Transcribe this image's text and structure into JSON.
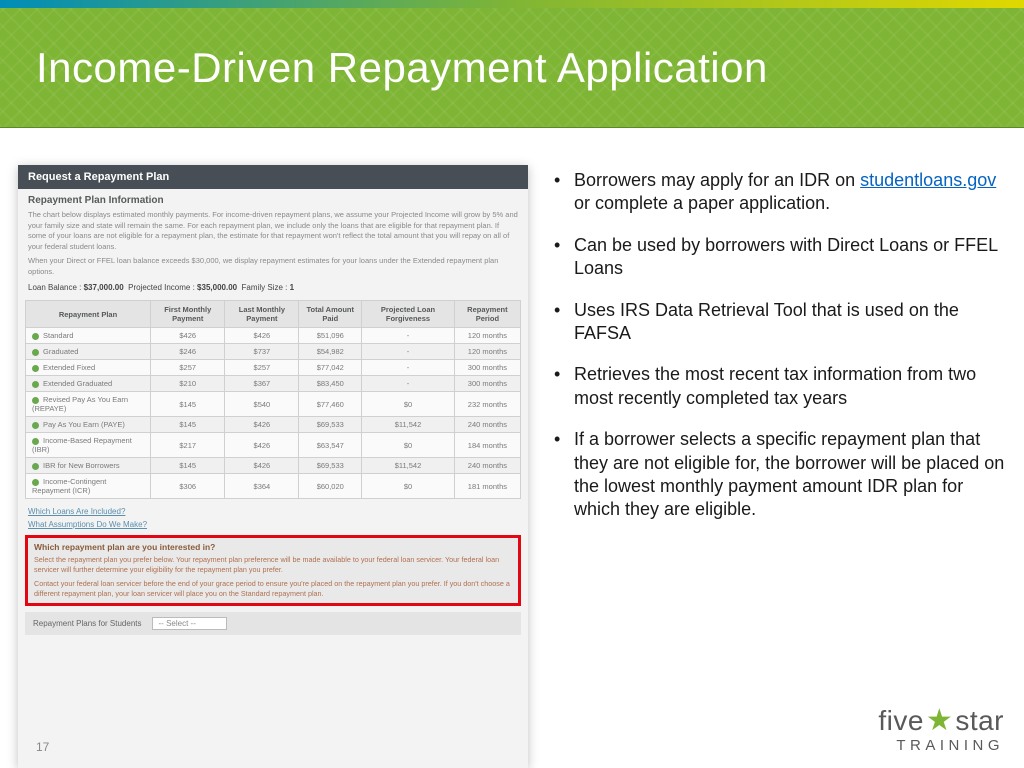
{
  "slide": {
    "title": "Income-Driven Repayment Application",
    "page_number": "17"
  },
  "bullets": [
    {
      "pre": "Borrowers may apply for an IDR on ",
      "link": "studentloans.gov",
      "post": " or complete a paper application."
    },
    {
      "pre": "Can be used by borrowers with Direct Loans or FFEL Loans",
      "link": "",
      "post": ""
    },
    {
      "pre": "Uses IRS Data Retrieval Tool that is used on the FAFSA",
      "link": "",
      "post": ""
    },
    {
      "pre": "Retrieves the most recent tax information from two most recently completed tax years",
      "link": "",
      "post": ""
    },
    {
      "pre": "If a borrower selects a specific repayment plan that they are not eligible for, the borrower will be placed on the lowest monthly payment amount IDR plan for which they are eligible.",
      "link": "",
      "post": ""
    }
  ],
  "screenshot": {
    "panel_title": "Request a Repayment Plan",
    "section_heading": "Repayment Plan Information",
    "description1": "The chart below displays estimated monthly payments. For income-driven repayment plans, we assume your Projected Income will grow by 5% and your family size and state will remain the same. For each repayment plan, we include only the loans that are eligible for that repayment plan. If some of your loans are not eligible for a repayment plan, the estimate for that repayment won't reflect the total amount that you will repay on all of your federal student loans.",
    "description2": "When your Direct or FFEL loan balance exceeds $30,000, we display repayment estimates for your loans under the Extended repayment plan options.",
    "loan_info": {
      "balance_label": "Loan Balance :",
      "balance": "$37,000.00",
      "income_label": "Projected Income :",
      "income": "$35,000.00",
      "family_label": "Family Size :",
      "family": "1"
    },
    "table_headers": [
      "Repayment Plan",
      "First Monthly Payment",
      "Last Monthly Payment",
      "Total Amount Paid",
      "Projected Loan Forgiveness",
      "Repayment Period"
    ],
    "table_rows": [
      {
        "plan": "Standard",
        "first": "$426",
        "last": "$426",
        "total": "$51,096",
        "forgive": "-",
        "period": "120 months"
      },
      {
        "plan": "Graduated",
        "first": "$246",
        "last": "$737",
        "total": "$54,982",
        "forgive": "-",
        "period": "120 months"
      },
      {
        "plan": "Extended Fixed",
        "first": "$257",
        "last": "$257",
        "total": "$77,042",
        "forgive": "-",
        "period": "300 months"
      },
      {
        "plan": "Extended Graduated",
        "first": "$210",
        "last": "$367",
        "total": "$83,450",
        "forgive": "-",
        "period": "300 months"
      },
      {
        "plan": "Revised Pay As You Earn (REPAYE)",
        "first": "$145",
        "last": "$540",
        "total": "$77,460",
        "forgive": "$0",
        "period": "232 months"
      },
      {
        "plan": "Pay As You Earn (PAYE)",
        "first": "$145",
        "last": "$426",
        "total": "$69,533",
        "forgive": "$11,542",
        "period": "240 months"
      },
      {
        "plan": "Income-Based Repayment (IBR)",
        "first": "$217",
        "last": "$426",
        "total": "$63,547",
        "forgive": "$0",
        "period": "184 months"
      },
      {
        "plan": "IBR for New Borrowers",
        "first": "$145",
        "last": "$426",
        "total": "$69,533",
        "forgive": "$11,542",
        "period": "240 months"
      },
      {
        "plan": "Income-Contingent Repayment (ICR)",
        "first": "$306",
        "last": "$364",
        "total": "$60,020",
        "forgive": "$0",
        "period": "181 months"
      }
    ],
    "link_loans": "Which Loans Are Included?",
    "link_assumptions": "What Assumptions Do We Make?",
    "redbox": {
      "title": "Which repayment plan are you interested in?",
      "text1": "Select the repayment plan you prefer below. Your repayment plan preference will be made available to your federal loan servicer. Your federal loan servicer will further determine your eligibility for the repayment plan you prefer.",
      "text2": "Contact your federal loan servicer before the end of your grace period to ensure you're placed on the repayment plan you prefer. If you don't choose a different repayment plan, your loan servicer will place you on the Standard repayment plan."
    },
    "select_label": "Repayment Plans for Students",
    "select_value": "-- Select --"
  },
  "logo": {
    "line1a": "five",
    "line1b": "star",
    "line2": "TRAINING"
  }
}
